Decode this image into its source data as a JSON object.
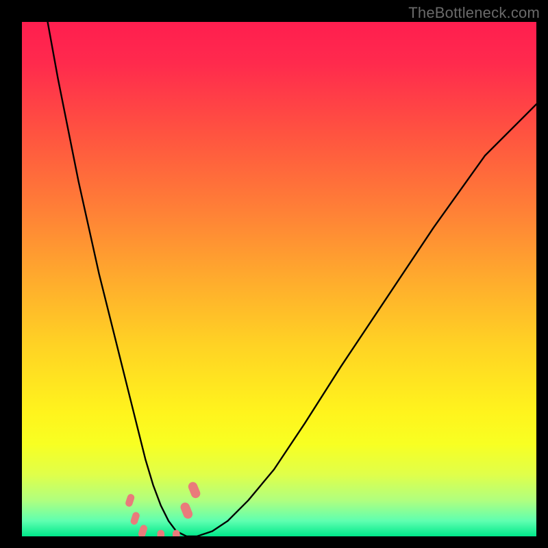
{
  "watermark": "TheBottleneck.com",
  "chart_data": {
    "type": "line",
    "title": "",
    "xlabel": "",
    "ylabel": "",
    "xlim": [
      0,
      100
    ],
    "ylim": [
      0,
      100
    ],
    "grid": false,
    "legend": false,
    "background_gradient": {
      "direction": "vertical",
      "stops": [
        {
          "pos": 0,
          "color": "#ff1e4f"
        },
        {
          "pos": 50,
          "color": "#ffab2d"
        },
        {
          "pos": 80,
          "color": "#fff41d"
        },
        {
          "pos": 100,
          "color": "#00e88a"
        }
      ]
    },
    "series": [
      {
        "name": "curve",
        "color": "#000000",
        "stroke_width": 2.4,
        "x": [
          5,
          7,
          9,
          11,
          13,
          15,
          17,
          19,
          21,
          22.5,
          24,
          25.5,
          27,
          28.5,
          30,
          32,
          34,
          37,
          40,
          44,
          49,
          55,
          62,
          70,
          80,
          90,
          100
        ],
        "y": [
          100,
          89,
          79,
          69,
          60,
          51,
          43,
          35,
          27,
          21,
          15,
          10,
          6,
          3,
          1,
          0,
          0,
          1,
          3,
          7,
          13,
          22,
          33,
          45,
          60,
          74,
          84
        ]
      }
    ],
    "markers": [
      {
        "name": "left-dot-1",
        "x": 21.0,
        "y": 7.0,
        "color": "#e97b7b",
        "r": 7
      },
      {
        "name": "left-dot-2",
        "x": 22.0,
        "y": 3.5,
        "color": "#e97b7b",
        "r": 7
      },
      {
        "name": "left-dot-3",
        "x": 23.5,
        "y": 1.0,
        "color": "#e97b7b",
        "r": 7
      },
      {
        "name": "bottom-dot-1",
        "x": 27.0,
        "y": 0.0,
        "color": "#e97b7b",
        "r": 7
      },
      {
        "name": "bottom-dot-2",
        "x": 30.0,
        "y": 0.0,
        "color": "#e97b7b",
        "r": 7
      },
      {
        "name": "right-dot-1",
        "x": 32.0,
        "y": 5.0,
        "color": "#e97b7b",
        "r": 9
      },
      {
        "name": "right-dot-2",
        "x": 33.5,
        "y": 9.0,
        "color": "#e97b7b",
        "r": 9
      }
    ]
  }
}
